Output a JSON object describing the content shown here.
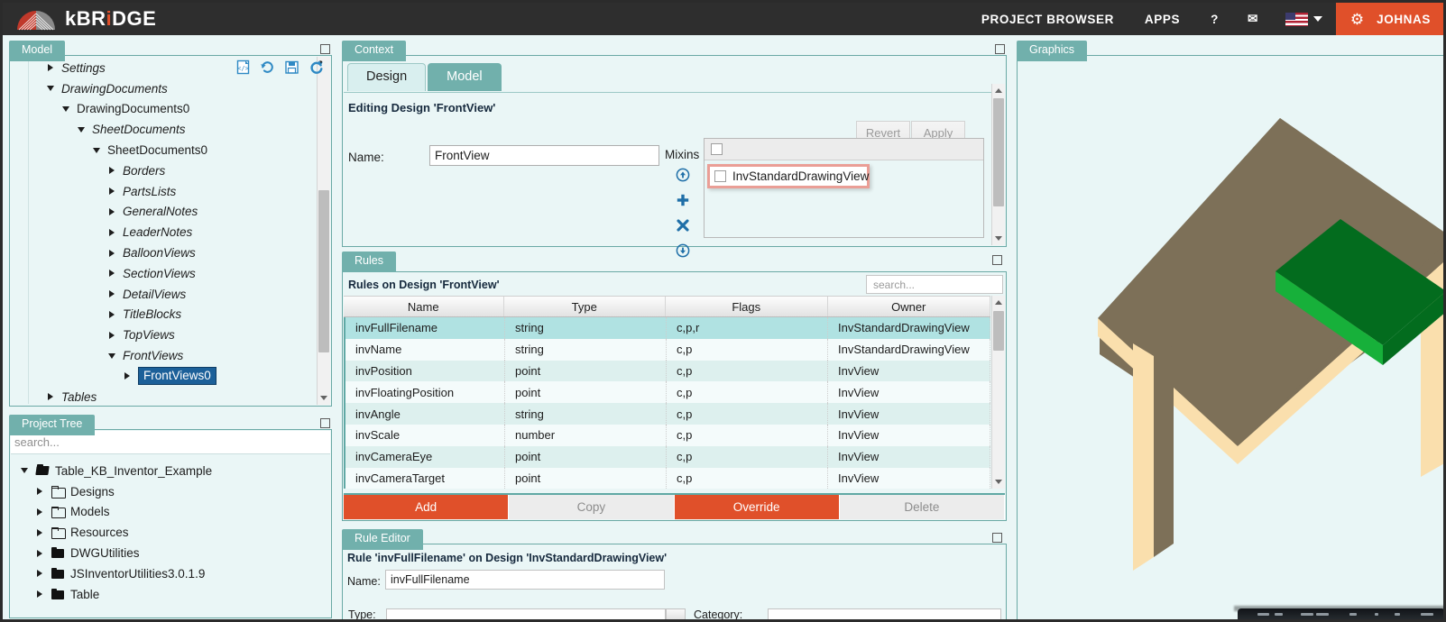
{
  "header": {
    "brand": "kBRiDGE",
    "brand_pre": "kBR",
    "brand_dot": "i",
    "brand_post": "DGE",
    "nav": [
      {
        "label": "PROJECT BROWSER",
        "name": "project-browser"
      },
      {
        "label": "APPS",
        "name": "apps"
      },
      {
        "label": "?",
        "name": "help"
      }
    ],
    "mail_icon": "✉",
    "flag_name": "us-flag-icon",
    "gear_icon": "✿",
    "user": "JOHNAS",
    "accent_color": "#e0502a",
    "bar_color": "#2e2e2e"
  },
  "model_panel": {
    "tab": "Model",
    "toolbar_icons": [
      "code-file-icon",
      "history-icon",
      "save-icon",
      "refresh-icon"
    ],
    "tree": [
      {
        "label": "Settings",
        "indent": 1,
        "state": "collapsed",
        "italic": true,
        "selected": false
      },
      {
        "label": "DrawingDocuments",
        "indent": 1,
        "state": "expanded",
        "italic": true,
        "selected": false
      },
      {
        "label": "DrawingDocuments0",
        "indent": 2,
        "state": "expanded",
        "italic": false,
        "selected": false
      },
      {
        "label": "SheetDocuments",
        "indent": 3,
        "state": "expanded",
        "italic": true,
        "selected": false
      },
      {
        "label": "SheetDocuments0",
        "indent": 4,
        "state": "expanded",
        "italic": false,
        "selected": false
      },
      {
        "label": "Borders",
        "indent": 5,
        "state": "collapsed",
        "italic": true,
        "selected": false
      },
      {
        "label": "PartsLists",
        "indent": 5,
        "state": "collapsed",
        "italic": true,
        "selected": false
      },
      {
        "label": "GeneralNotes",
        "indent": 5,
        "state": "collapsed",
        "italic": true,
        "selected": false
      },
      {
        "label": "LeaderNotes",
        "indent": 5,
        "state": "collapsed",
        "italic": true,
        "selected": false
      },
      {
        "label": "BalloonViews",
        "indent": 5,
        "state": "collapsed",
        "italic": true,
        "selected": false
      },
      {
        "label": "SectionViews",
        "indent": 5,
        "state": "collapsed",
        "italic": true,
        "selected": false
      },
      {
        "label": "DetailViews",
        "indent": 5,
        "state": "collapsed",
        "italic": true,
        "selected": false
      },
      {
        "label": "TitleBlocks",
        "indent": 5,
        "state": "collapsed",
        "italic": true,
        "selected": false
      },
      {
        "label": "TopViews",
        "indent": 5,
        "state": "collapsed",
        "italic": true,
        "selected": false
      },
      {
        "label": "FrontViews",
        "indent": 5,
        "state": "expanded",
        "italic": true,
        "selected": false
      },
      {
        "label": "FrontViews0",
        "indent": 6,
        "state": "collapsed",
        "italic": false,
        "selected": true
      },
      {
        "label": "Tables",
        "indent": 1,
        "state": "collapsed",
        "italic": true,
        "selected": false
      }
    ]
  },
  "project_panel": {
    "tab": "Project Tree",
    "search_placeholder": "search...",
    "search_value": "",
    "tree": [
      {
        "label": "Table_KB_Inventor_Example",
        "indent": 0,
        "state": "expanded",
        "icon": "folder-open"
      },
      {
        "label": "Designs",
        "indent": 1,
        "state": "collapsed",
        "icon": "folder-closed"
      },
      {
        "label": "Models",
        "indent": 1,
        "state": "collapsed",
        "icon": "folder-closed"
      },
      {
        "label": "Resources",
        "indent": 1,
        "state": "collapsed",
        "icon": "folder-closed"
      },
      {
        "label": "DWGUtilities",
        "indent": 1,
        "state": "collapsed",
        "icon": "folder-solid"
      },
      {
        "label": "JSInventorUtilities3.0.1.9",
        "indent": 1,
        "state": "collapsed",
        "icon": "folder-solid"
      },
      {
        "label": "Table",
        "indent": 1,
        "state": "collapsed",
        "icon": "folder-solid"
      }
    ]
  },
  "context_panel": {
    "tab": "Context",
    "tabs": [
      {
        "label": "Design",
        "active": false
      },
      {
        "label": "Model",
        "active": true
      }
    ],
    "editing_title": "Editing Design 'FrontView'",
    "revert_label": "Revert",
    "apply_label": "Apply",
    "name_label": "Name:",
    "name_value": "FrontView",
    "mixins_label": "Mixins",
    "mixin_buttons": [
      "move-up-icon",
      "add-icon",
      "remove-icon",
      "move-down-icon"
    ],
    "mixin_items": [
      {
        "label": "InvStandardDrawingView",
        "checked": false,
        "highlighted": true
      }
    ]
  },
  "rules_panel": {
    "tab": "Rules",
    "title": "Rules on Design 'FrontView'",
    "search_placeholder": "search...",
    "search_value": "",
    "columns": [
      "Name",
      "Type",
      "Flags",
      "Owner"
    ],
    "rows": [
      {
        "name": "invFullFilename",
        "type": "string",
        "flags": "c,p,r",
        "owner": "InvStandardDrawingView",
        "selected": true
      },
      {
        "name": "invName",
        "type": "string",
        "flags": "c,p",
        "owner": "InvStandardDrawingView",
        "selected": false
      },
      {
        "name": "invPosition",
        "type": "point",
        "flags": "c,p",
        "owner": "InvView",
        "selected": false
      },
      {
        "name": "invFloatingPosition",
        "type": "point",
        "flags": "c,p",
        "owner": "InvView",
        "selected": false
      },
      {
        "name": "invAngle",
        "type": "string",
        "flags": "c,p",
        "owner": "InvView",
        "selected": false
      },
      {
        "name": "invScale",
        "type": "number",
        "flags": "c,p",
        "owner": "InvView",
        "selected": false
      },
      {
        "name": "invCameraEye",
        "type": "point",
        "flags": "c,p",
        "owner": "InvView",
        "selected": false
      },
      {
        "name": "invCameraTarget",
        "type": "point",
        "flags": "c,p",
        "owner": "InvView",
        "selected": false
      }
    ],
    "actions": [
      {
        "label": "Add",
        "style": "primary"
      },
      {
        "label": "Copy",
        "style": "disabled"
      },
      {
        "label": "Override",
        "style": "primary"
      },
      {
        "label": "Delete",
        "style": "disabled"
      }
    ]
  },
  "rule_editor": {
    "tab": "Rule Editor",
    "title": "Rule 'invFullFilename' on Design 'InvStandardDrawingView'",
    "name_label": "Name:",
    "name_value": "invFullFilename",
    "type_label": "Type:",
    "category_label": "Category:"
  },
  "graphics_panel": {
    "tab": "Graphics",
    "scene": {
      "description": "isometric table with green block on top",
      "table_top_color": "#7d7058",
      "table_edge_color": "#fadfad",
      "block_top_color": "#036c1e",
      "block_side_color": "#17b03a",
      "background_color": "#e9f6f6"
    }
  }
}
